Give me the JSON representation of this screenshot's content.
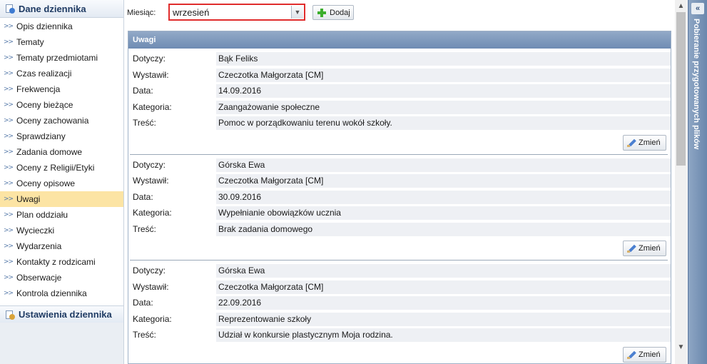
{
  "sidebar": {
    "section1_title": "Dane dziennika",
    "items": [
      {
        "label": "Opis dziennika"
      },
      {
        "label": "Tematy"
      },
      {
        "label": "Tematy przedmiotami"
      },
      {
        "label": "Czas realizacji"
      },
      {
        "label": "Frekwencja"
      },
      {
        "label": "Oceny bieżące"
      },
      {
        "label": "Oceny zachowania"
      },
      {
        "label": "Sprawdziany"
      },
      {
        "label": "Zadania domowe"
      },
      {
        "label": "Oceny z Religii/Etyki"
      },
      {
        "label": "Oceny opisowe"
      },
      {
        "label": "Uwagi",
        "active": true
      },
      {
        "label": "Plan oddziału"
      },
      {
        "label": "Wycieczki"
      },
      {
        "label": "Wydarzenia"
      },
      {
        "label": "Kontakty z rodzicami"
      },
      {
        "label": "Obserwacje"
      },
      {
        "label": "Kontrola dziennika"
      }
    ],
    "section2_title": "Ustawienia dziennika"
  },
  "toolbar": {
    "month_label": "Miesiąc:",
    "month_value": "wrzesień",
    "add_label": "Dodaj"
  },
  "panel": {
    "title": "Uwagi",
    "field_labels": {
      "dotyczy": "Dotyczy:",
      "wystawil": "Wystawił:",
      "data": "Data:",
      "kategoria": "Kategoria:",
      "tresc": "Treść:"
    },
    "edit_label": "Zmień",
    "notes": [
      {
        "dotyczy": "Bąk Feliks",
        "wystawil": "Czeczotka Małgorzata [CM]",
        "data": "14.09.2016",
        "kategoria": "Zaangażowanie społeczne",
        "tresc": "Pomoc w porządkowaniu terenu wokół szkoły."
      },
      {
        "dotyczy": "Górska Ewa",
        "wystawil": "Czeczotka Małgorzata [CM]",
        "data": "30.09.2016",
        "kategoria": "Wypełnianie obowiązków ucznia",
        "tresc": "Brak zadania domowego"
      },
      {
        "dotyczy": "Górska Ewa",
        "wystawil": "Czeczotka Małgorzata [CM]",
        "data": "22.09.2016",
        "kategoria": "Reprezentowanie szkoły",
        "tresc": "Udział w konkursie plastycznym Moja rodzina."
      }
    ]
  },
  "right_panel": {
    "title": "Pobieranie przygotowanych plików"
  },
  "icons": {
    "menu_bullet": "double-chevron-right-icon",
    "dropdown": "chevron-down-icon",
    "add": "plus-icon",
    "edit": "pencil-icon",
    "collapse": "double-chevron-left-icon"
  },
  "colors": {
    "active_item": "#fce4a4",
    "panel_header": "#7f99bd",
    "select_border": "#e02c2c",
    "right_panel": "#7b96b9"
  }
}
